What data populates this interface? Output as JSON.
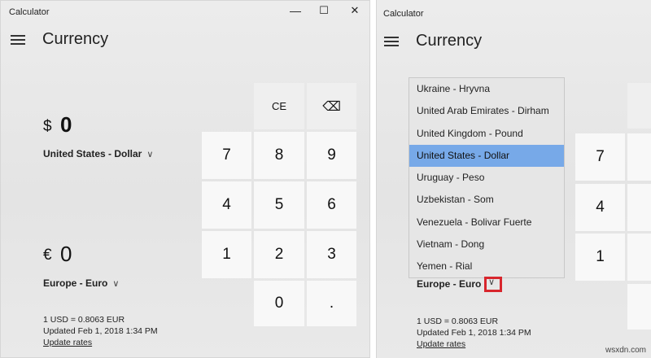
{
  "left": {
    "app_title": "Calculator",
    "controls": {
      "minimize": "—",
      "maximize": "☐",
      "close": "✕"
    },
    "mode_title": "Currency",
    "from": {
      "symbol": "$",
      "value": "0",
      "unit": "United States - Dollar"
    },
    "to": {
      "symbol": "€",
      "value": "0",
      "unit": "Europe - Euro"
    },
    "rate_info": "1 USD = 0.8063 EUR",
    "updated": "Updated Feb 1, 2018 1:34 PM",
    "update_link": "Update rates",
    "keys": {
      "ce": "CE",
      "backspace": "⌫",
      "k7": "7",
      "k8": "8",
      "k9": "9",
      "k4": "4",
      "k5": "5",
      "k6": "6",
      "k1": "1",
      "k2": "2",
      "k3": "3",
      "k0": "0",
      "dot": "."
    }
  },
  "right": {
    "app_title": "Calculator",
    "mode_title": "Currency",
    "dropdown_items": [
      "Ukraine - Hryvna",
      "United Arab Emirates - Dirham",
      "United Kingdom - Pound",
      "United States - Dollar",
      "Uruguay - Peso",
      "Uzbekistan - Som",
      "Venezuela - Bolivar Fuerte",
      "Vietnam - Dong",
      "Yemen - Rial"
    ],
    "selected_index": 3,
    "to_unit": "Europe - Euro",
    "rate_info": "1 USD = 0.8063 EUR",
    "updated": "Updated Feb 1, 2018 1:34 PM",
    "update_link": "Update rates",
    "keys": {
      "k7": "7",
      "k4": "4",
      "k1": "1"
    }
  },
  "watermark": "wsxdn.com",
  "colors": {
    "selected_item": "#77a9e8",
    "highlight_box": "#d8262d"
  }
}
